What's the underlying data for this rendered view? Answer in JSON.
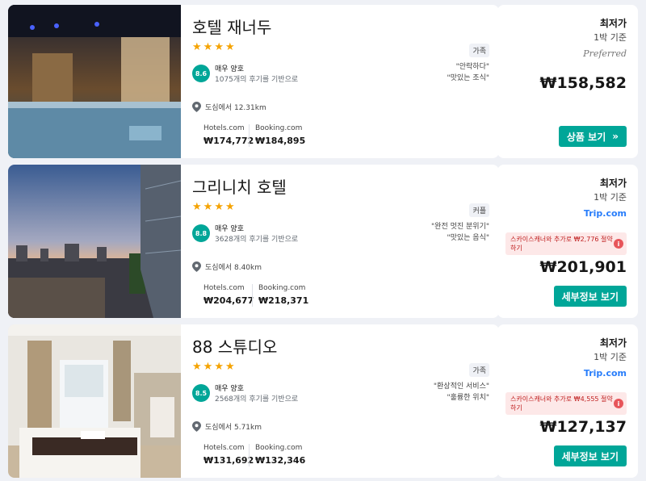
{
  "common": {
    "lowest_label": "최저가",
    "nightly_label": "1박 기준",
    "provider_a": "Hotels.com",
    "provider_b": "Booking.com"
  },
  "hotels": [
    {
      "name": "호텔 재너두",
      "stars": 4,
      "tag": "가족",
      "score": "8.6",
      "rating_label": "매우 양호",
      "reviews": "1075개의 후기를 기반으로",
      "quotes": [
        "\"안락하다\"",
        "\"맛있는 조식\""
      ],
      "distance": "도심에서 12.31km",
      "price_a": "₩174,772",
      "price_b": "₩184,895",
      "partner": "Preferred",
      "price": "₩158,582",
      "savings": "",
      "button": "상품 보기",
      "button_icon": "chevrons-right-icon"
    },
    {
      "name": "그리니치 호텔",
      "stars": 4,
      "tag": "커플",
      "score": "8.8",
      "rating_label": "매우 양호",
      "reviews": "3628개의 후기를 기반으로",
      "quotes": [
        "\"완전 멋진 분위기\"",
        "\"맛있는 음식\""
      ],
      "distance": "도심에서 8.40km",
      "price_a": "₩204,677",
      "price_b": "₩218,371",
      "partner": "Trip.com",
      "price": "₩201,901",
      "savings": "스카이스캐너와 추가로 ₩2,776 절약하기",
      "button": "세부정보 보기"
    },
    {
      "name": "88 스튜디오",
      "stars": 4,
      "tag": "가족",
      "score": "8.5",
      "rating_label": "매우 양호",
      "reviews": "2568개의 후기를 기반으로",
      "quotes": [
        "\"환상적인 서비스\"",
        "\"훌륭한 위치\""
      ],
      "distance": "도심에서 5.71km",
      "price_a": "₩131,692",
      "price_b": "₩132,346",
      "partner": "Trip.com",
      "price": "₩127,137",
      "savings": "스카이스캐너와 추가로 ₩4,555 절약하기",
      "button": "세부정보 보기"
    }
  ],
  "colors": {
    "accent": "#00a698",
    "star": "#f5a300",
    "savings_bg": "#fde8e8",
    "savings_text": "#c02020",
    "trip": "#287dfa"
  }
}
